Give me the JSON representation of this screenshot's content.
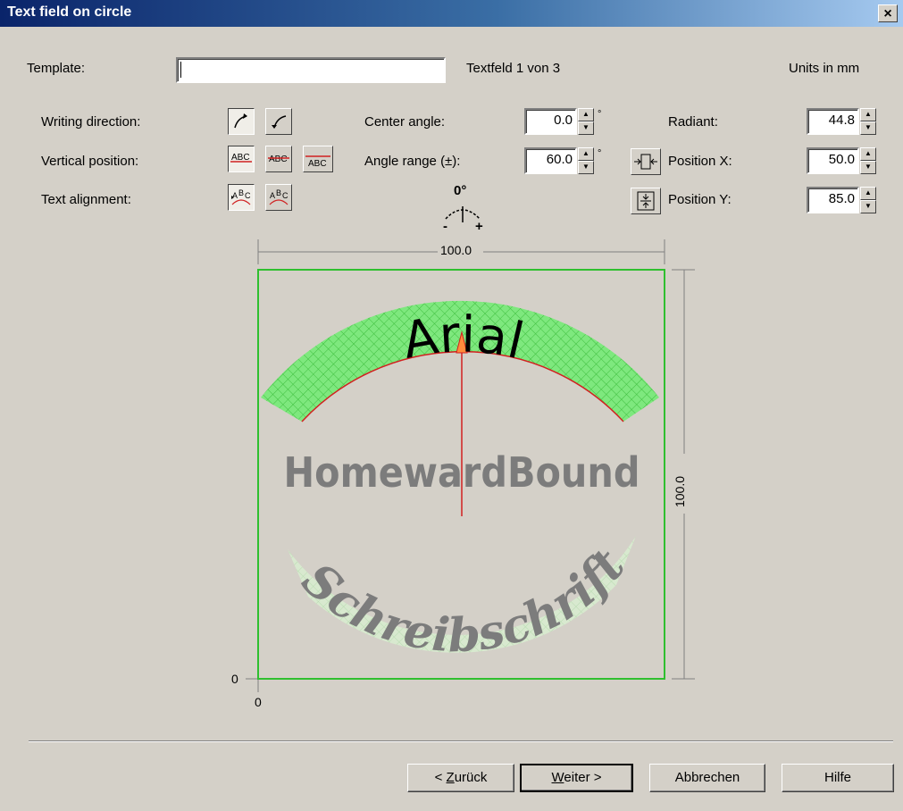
{
  "window": {
    "title": "Text field on circle",
    "close_glyph": "×"
  },
  "template": {
    "label": "Template:",
    "value": ""
  },
  "field_counter": "Textfeld 1 von 3",
  "units": "Units in mm",
  "labels": {
    "writing_direction": "Writing direction:",
    "vertical_position": "Vertical position:",
    "text_alignment": "Text alignment:",
    "center_angle": "Center angle:",
    "angle_range": "Angle range (±):",
    "radiant": "Radiant:",
    "position_x": "Position X:",
    "position_y": "Position Y:"
  },
  "values": {
    "center_angle": "0.0",
    "angle_range": "60.0",
    "radiant": "44.8",
    "position_x": "50.0",
    "position_y": "85.0"
  },
  "degree_symbol": "°",
  "angle_indicator": {
    "zero": "0°",
    "minus": "-",
    "plus": "+"
  },
  "preview": {
    "width_label": "100.0",
    "height_label": "100.0",
    "origin_y": "0",
    "origin_x": "0",
    "sample_texts": [
      "Arial",
      "HomewardBound",
      "Schreibschrift"
    ],
    "colors": {
      "frame": "#2fbf2f",
      "active_fill": "#7ee87e",
      "inactive_fill": "#cde8c0",
      "arc": "#d22020",
      "gray_text": "#7c7c7c"
    }
  },
  "buttons": {
    "back": {
      "pre": "< ",
      "mnemonic": "Z",
      "rest": "urück"
    },
    "next": {
      "mnemonic": "W",
      "rest": "eiter >"
    },
    "cancel": "Abbrechen",
    "help": "Hilfe"
  },
  "icons": [
    "writing-direction-cw-icon",
    "writing-direction-ccw-icon",
    "vpos-above-icon",
    "vpos-center-icon",
    "vpos-below-icon",
    "align-left-icon",
    "align-center-icon",
    "fit-width-icon",
    "fit-height-icon",
    "angle-indicator-icon"
  ]
}
